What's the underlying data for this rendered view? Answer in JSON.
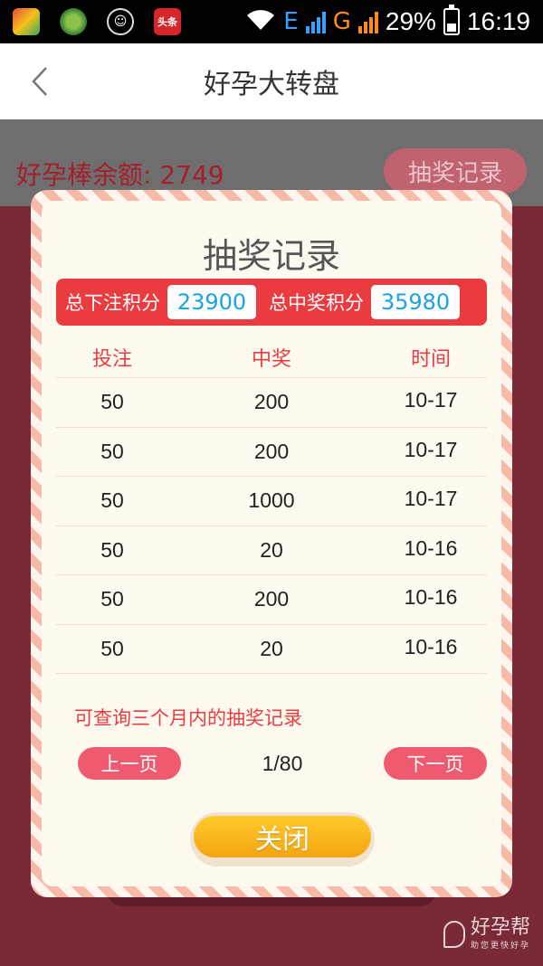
{
  "status_bar": {
    "app_icons": [
      "browser-icon",
      "lottery-app-icon",
      "mask-face-icon",
      "toutiao-app-icon"
    ],
    "app_badge_text": "头条",
    "network_e": "E",
    "network_g": "G",
    "battery_percent": "29%",
    "time": "16:19"
  },
  "navbar": {
    "title": "好孕大转盘",
    "back_icon": "chevron-left-icon"
  },
  "background": {
    "balance_text": "好孕棒余额: 2749",
    "record_button": "抽奖记录"
  },
  "modal": {
    "title": "抽奖记录",
    "totals": {
      "bet_label": "总下注积分",
      "bet_value": "23900",
      "win_label": "总中奖积分",
      "win_value": "35980"
    },
    "table": {
      "headers": [
        "投注",
        "中奖",
        "时间"
      ],
      "rows": [
        [
          "50",
          "200",
          "10-17"
        ],
        [
          "50",
          "200",
          "10-17"
        ],
        [
          "50",
          "1000",
          "10-17"
        ],
        [
          "50",
          "20",
          "10-16"
        ],
        [
          "50",
          "200",
          "10-16"
        ],
        [
          "50",
          "20",
          "10-16"
        ]
      ]
    },
    "note": "可查询三个月内的抽奖记录",
    "pager": {
      "prev": "上一页",
      "page": "1/80",
      "next": "下一页"
    },
    "close": "关闭"
  },
  "watermark": {
    "brand": "好孕帮",
    "tagline": "助您更快好孕"
  },
  "colors": {
    "accent_red": "#ea3c40",
    "page_button_pink": "#ef5a6e",
    "value_blue": "#1aa3e0",
    "close_orange": "#f3a411",
    "backdrop": "#7a2a36"
  }
}
